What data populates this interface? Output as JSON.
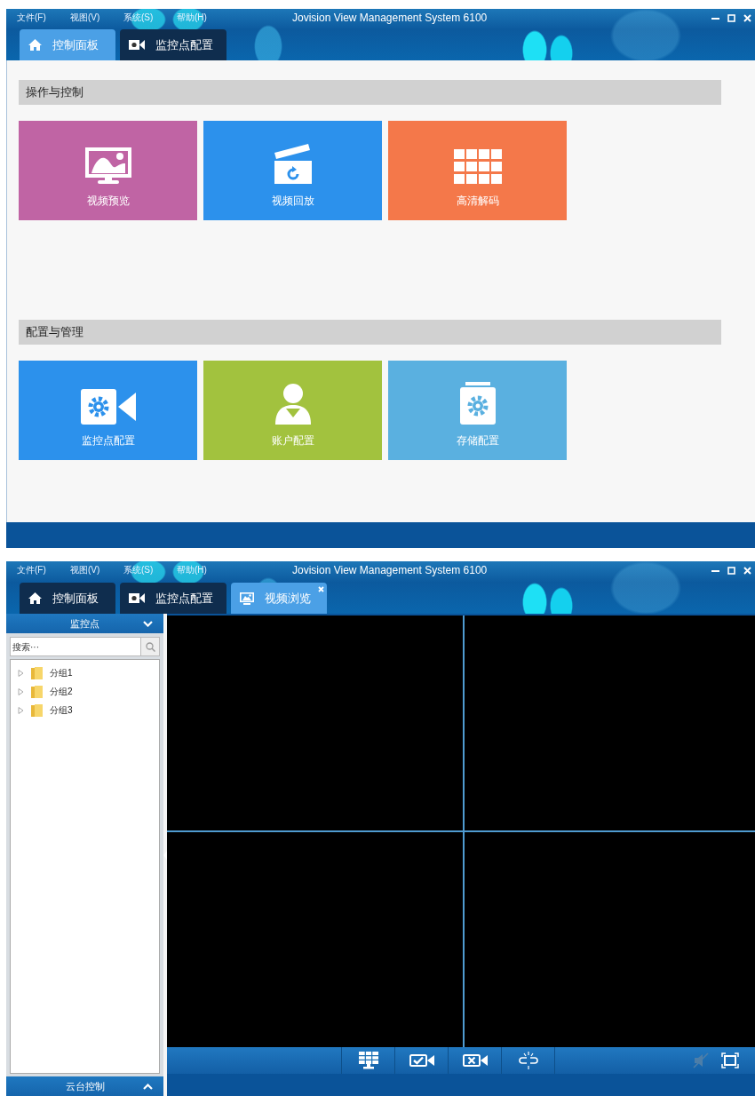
{
  "screens": [
    {
      "menu": [
        "文件(F)",
        "视图(V)",
        "系统(S)",
        "帮助(H)"
      ],
      "title": "Jovision View Management System 6100",
      "tabs": [
        {
          "label": "控制面板",
          "kind": "home",
          "selected": true,
          "closable": false
        },
        {
          "label": "监控点配置",
          "kind": "camera",
          "selected": false,
          "closable": false
        }
      ],
      "dashboard": {
        "sections": [
          {
            "title": "操作与控制",
            "tiles": [
              {
                "label": "视频预览",
                "kind": "monitor",
                "color": "#c064a4"
              },
              {
                "label": "视频回放",
                "kind": "clapper",
                "color": "#2c91ec"
              },
              {
                "label": "高清解码",
                "kind": "grid",
                "color": "#f4784a"
              }
            ]
          },
          {
            "title": "配置与管理",
            "tiles": [
              {
                "label": "监控点配置",
                "kind": "camera",
                "color": "#2c91ec"
              },
              {
                "label": "账户配置",
                "kind": "user",
                "color": "#a2c23e"
              },
              {
                "label": "存储配置",
                "kind": "storage",
                "color": "#5ab0e0"
              }
            ]
          }
        ]
      }
    },
    {
      "menu": [
        "文件(F)",
        "视图(V)",
        "系统(S)",
        "帮助(H)"
      ],
      "title": "Jovision View Management System 6100",
      "tabs": [
        {
          "label": "控制面板",
          "kind": "home",
          "selected": false,
          "closable": false
        },
        {
          "label": "监控点配置",
          "kind": "camera",
          "selected": false,
          "closable": false
        },
        {
          "label": "视频浏览",
          "kind": "monitor",
          "selected": true,
          "closable": true
        }
      ],
      "sidebar": {
        "header": "监控点",
        "search": {
          "placeholder": "搜索···"
        },
        "tree": [
          {
            "label": "分组1",
            "expanded": false
          },
          {
            "label": "分组2",
            "expanded": false
          },
          {
            "label": "分组3",
            "expanded": false
          }
        ],
        "footer": "云台控制"
      }
    }
  ]
}
